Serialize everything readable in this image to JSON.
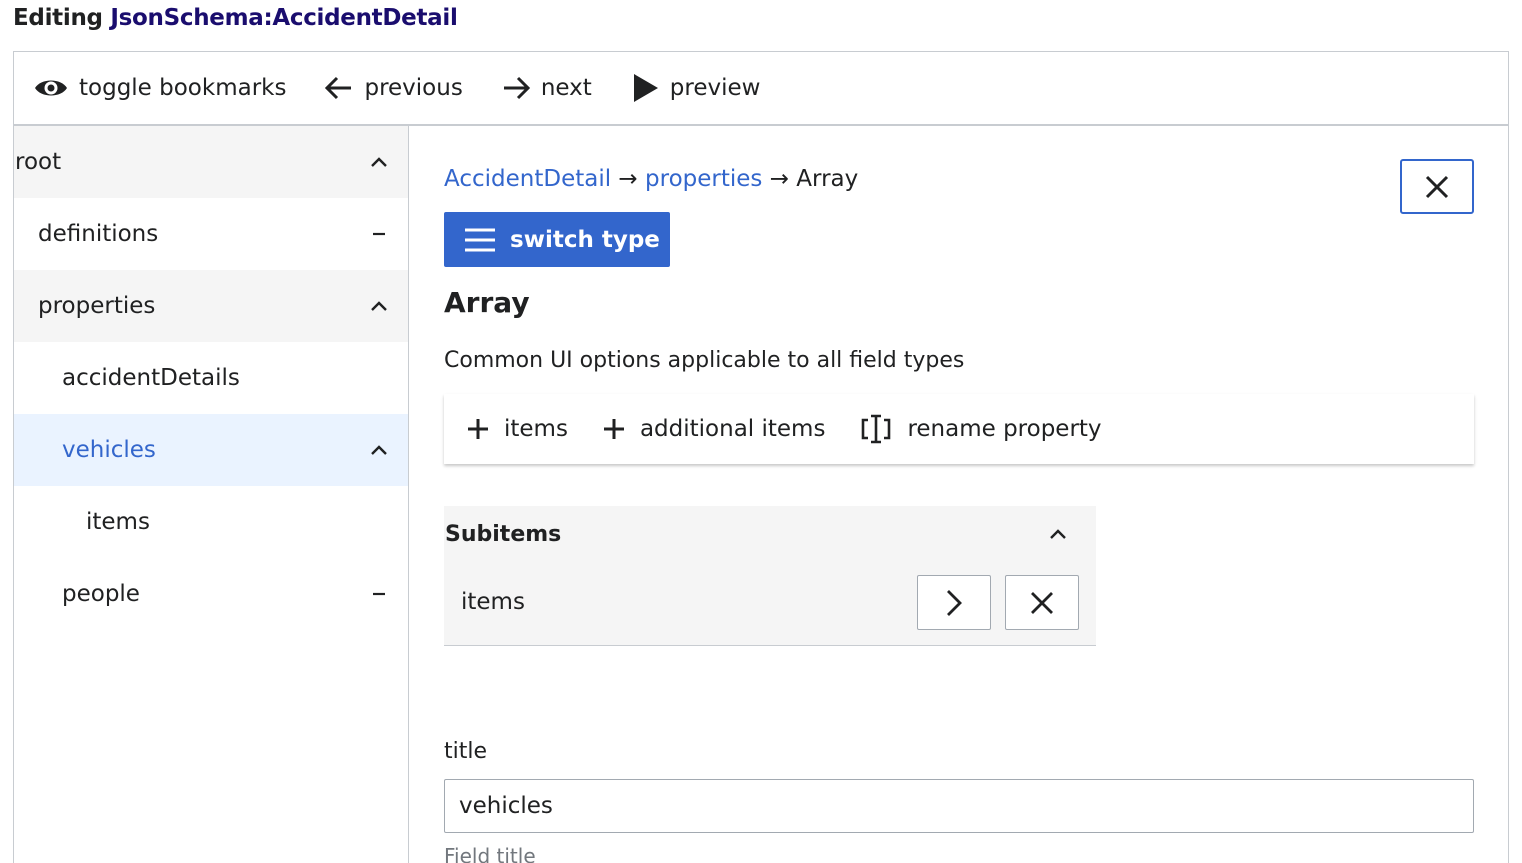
{
  "header": {
    "prefix": "Editing",
    "page_link": "JsonSchema:AccidentDetail"
  },
  "toolbar": {
    "toggle_bookmarks": "toggle bookmarks",
    "previous": "previous",
    "next": "next",
    "preview": "preview"
  },
  "tree": {
    "items": [
      {
        "label": "root",
        "state": "expanded"
      },
      {
        "label": "definitions",
        "state": "collapsed"
      },
      {
        "label": "properties",
        "state": "expanded"
      },
      {
        "label": "accidentDetails",
        "state": "leaf"
      },
      {
        "label": "vehicles",
        "state": "expanded",
        "selected": true
      },
      {
        "label": "items",
        "state": "leaf"
      },
      {
        "label": "people",
        "state": "collapsed"
      }
    ]
  },
  "main": {
    "breadcrumb": {
      "crumb1": "AccidentDetail",
      "sep1": "→",
      "crumb2": "properties",
      "sep2": "→",
      "current": "Array"
    },
    "switch_type": "switch type",
    "type_title": "Array",
    "description": "Common UI options applicable to all field types",
    "actions": {
      "items": "items",
      "additional_items": "additional items",
      "rename_property": "rename property"
    },
    "subitems": {
      "title": "Subitems",
      "row_label": "items"
    },
    "title_field": {
      "label": "title",
      "value": "vehicles",
      "help": "Field title"
    }
  },
  "colors": {
    "accent": "#3366cc",
    "heading_link": "#1a0d6e",
    "selected_bg": "#eaf3ff",
    "shade_bg": "#f5f5f5",
    "border": "#c8ccd1"
  }
}
